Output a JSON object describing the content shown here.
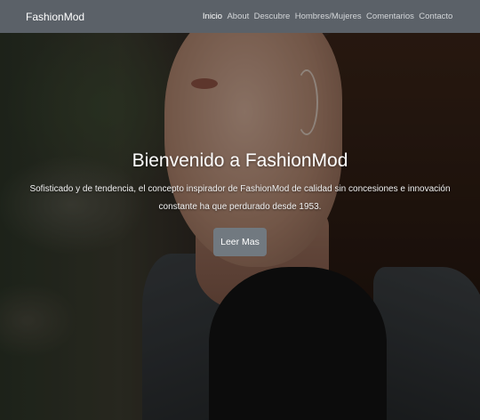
{
  "navbar": {
    "brand": "FashionMod",
    "links": [
      {
        "label": "Inicio",
        "active": true
      },
      {
        "label": "About",
        "active": false
      },
      {
        "label": "Descubre",
        "active": false
      },
      {
        "label": "Hombres/Mujeres",
        "active": false
      },
      {
        "label": "Comentarios",
        "active": false
      },
      {
        "label": "Contacto",
        "active": false
      }
    ]
  },
  "hero": {
    "title": "Bienvenido a FashionMod",
    "subtitle": "Sofisticado y de tendencia, el concepto inspirador de FashionMod de calidad sin concesiones e innovación constante ha que perdurado desde 1953.",
    "button_label": "Leer Mas"
  },
  "colors": {
    "navbar_bg": "#5b6168",
    "button_bg": "#717980",
    "text": "#ffffff"
  }
}
